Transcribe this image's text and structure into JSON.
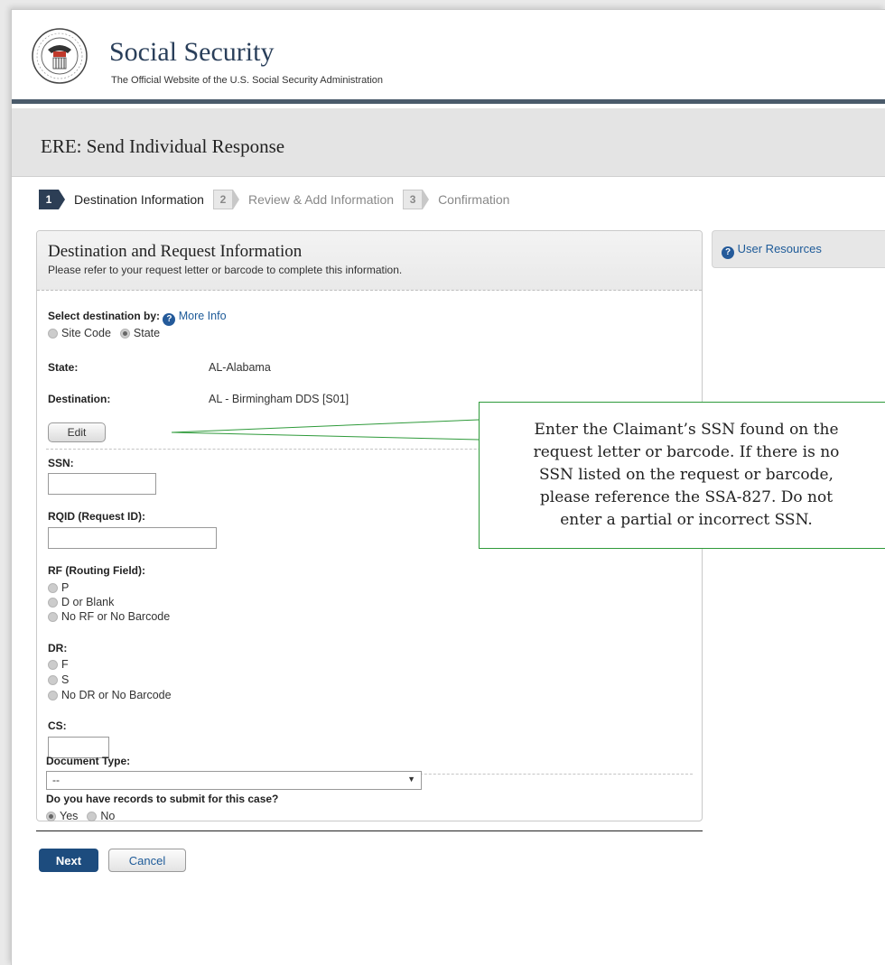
{
  "header": {
    "seal_icon": "ssa-seal-icon",
    "title": "Social Security",
    "subtitle": "The Official Website of the U.S. Social Security Administration"
  },
  "page": {
    "title": "ERE: Send Individual Response"
  },
  "steps": [
    {
      "number": "1",
      "label": "Destination Information",
      "active": true
    },
    {
      "number": "2",
      "label": "Review & Add Information",
      "active": false
    },
    {
      "number": "3",
      "label": "Confirmation",
      "active": false
    }
  ],
  "panel": {
    "title": "Destination and Request Information",
    "description": "Please refer to your request letter or barcode to complete this information.",
    "select_by": {
      "label": "Select destination by:",
      "more_info": "More Info",
      "options": [
        "Site Code",
        "State"
      ],
      "selected": "State"
    },
    "state": {
      "label": "State:",
      "value": "AL-Alabama"
    },
    "destination": {
      "label": "Destination:",
      "value": "AL - Birmingham DDS [S01]"
    },
    "edit_label": "Edit",
    "ssn": {
      "label": "SSN:",
      "value": ""
    },
    "rqid": {
      "label": "RQID (Request ID):",
      "value": ""
    },
    "rf": {
      "label": "RF (Routing Field):",
      "options": [
        "P",
        "D or Blank",
        "No RF or No Barcode"
      ]
    },
    "dr": {
      "label": "DR:",
      "options": [
        "F",
        "S",
        "No DR or No Barcode"
      ]
    },
    "cs": {
      "label": "CS:",
      "value": ""
    },
    "records": {
      "label": "Do you have records to submit for this case?",
      "options": [
        "Yes",
        "No"
      ],
      "selected": "Yes"
    },
    "document_type": {
      "label": "Document Type:",
      "selected": "--"
    }
  },
  "actions": {
    "next_label": "Next",
    "cancel_label": "Cancel"
  },
  "sidebar": {
    "resources_label": "User Resources"
  },
  "callout": {
    "lines": [
      "Enter the Claimant’s SSN found on the",
      "request letter or barcode. If there is no",
      "SSN listed on the request or barcode,",
      "please reference the SSA-827.  Do not",
      "enter a partial or incorrect SSN."
    ]
  },
  "colors": {
    "brand": "#2a3f5a",
    "accent": "#1d4c7e",
    "callout_border": "#2e9a3a"
  }
}
